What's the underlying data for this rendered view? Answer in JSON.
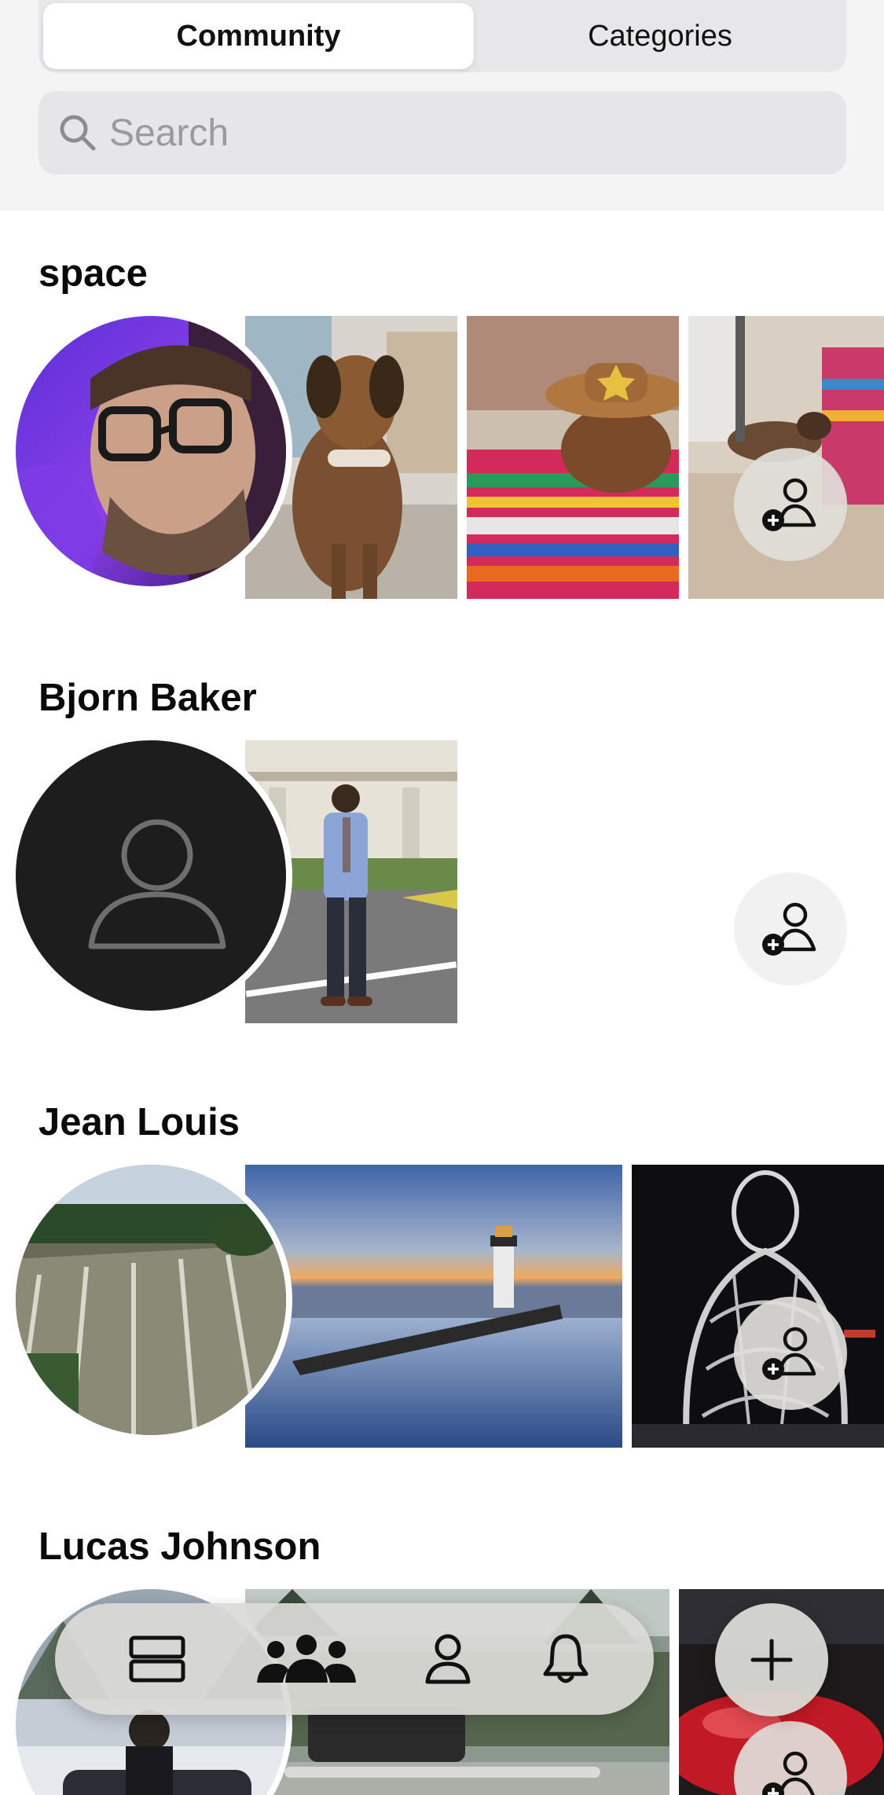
{
  "segments": {
    "community": "Community",
    "categories": "Categories",
    "active": "Community"
  },
  "search": {
    "placeholder": "Search",
    "value": "",
    "icon": "magnifier-icon"
  },
  "sections": [
    {
      "name": "space",
      "avatar": "person-with-glasses-selfie",
      "photos": [
        "dog-with-bone",
        "dog-in-cowboy-hat",
        "dog-lying-on-floor"
      ]
    },
    {
      "name": "Bjorn Baker",
      "avatar": "default-user-placeholder",
      "photos": [
        "man-standing-in-street"
      ]
    },
    {
      "name": "Jean Louis",
      "avatar": "aerial-farm-fields",
      "photos": [
        "lighthouse-at-sunset",
        "wire-sculpture-at-night"
      ]
    },
    {
      "name": "Lucas Johnson",
      "avatar": "person-in-snow-with-car",
      "photos": [
        "truck-in-forest",
        "red-car"
      ]
    }
  ],
  "tabbar": {
    "items": [
      {
        "name": "feed",
        "icon": "feed-icon"
      },
      {
        "name": "community",
        "icon": "community-icon",
        "active": true
      },
      {
        "name": "profile",
        "icon": "profile-icon"
      },
      {
        "name": "notifications",
        "icon": "bell-icon"
      }
    ],
    "fab_icon": "plus-icon"
  },
  "colors": {
    "background": "#ffffff",
    "header": "#f4f4f5",
    "segment_track": "#e7e7ea",
    "text": "#111111"
  }
}
